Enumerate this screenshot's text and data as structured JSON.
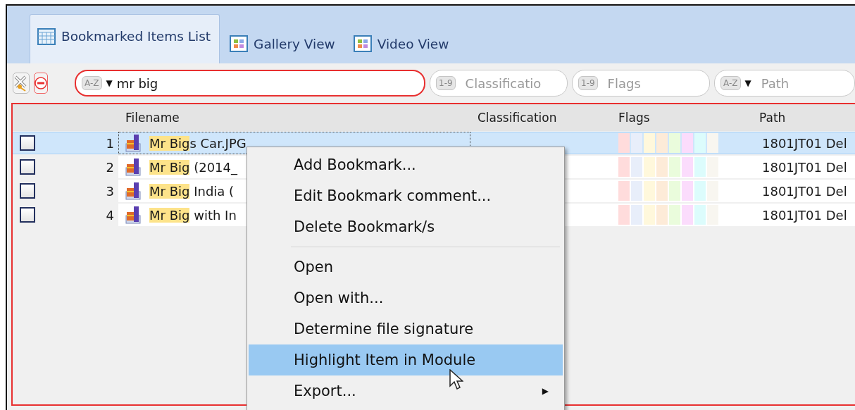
{
  "tabs": [
    {
      "label": "Bookmarked Items List",
      "selected": true,
      "kind": "table"
    },
    {
      "label": "Gallery View",
      "selected": false,
      "kind": "grid"
    },
    {
      "label": "Video View",
      "selected": false,
      "kind": "grid"
    }
  ],
  "filters": [
    {
      "badge": "A-Z",
      "caret": "▼",
      "value": "mr big",
      "active": true
    },
    {
      "badge": "1-9",
      "placeholder": "Classificatio",
      "active": false
    },
    {
      "badge": "1-9",
      "placeholder": "Flags",
      "active": false
    },
    {
      "badge": "A-Z",
      "caret": "▼",
      "placeholder": "Path",
      "active": false
    }
  ],
  "table": {
    "columns": [
      "Filename",
      "Classification",
      "Flags",
      "Path"
    ],
    "flag_slots": [
      {
        "color": "#ffdcdc"
      },
      {
        "color": "#e8eefa"
      },
      {
        "color": "#fff8dc"
      },
      {
        "color": "#fdebd8"
      },
      {
        "color": "#eafcdc"
      },
      {
        "color": "#fbdcfc"
      },
      {
        "color": "#dcfcfc"
      },
      {
        "color": "#f8f6f0"
      }
    ],
    "rows": [
      {
        "checked": false,
        "selected": true,
        "number": "1",
        "match": "Mr Big",
        "rest": "s Car.JPG",
        "path": "1801JT01 Del"
      },
      {
        "checked": false,
        "selected": false,
        "number": "2",
        "match": "Mr Big",
        "rest": " (2014_",
        "path": "1801JT01 Del"
      },
      {
        "checked": false,
        "selected": false,
        "number": "3",
        "match": "Mr Big",
        "rest": " India (",
        "path": "1801JT01 Del"
      },
      {
        "checked": false,
        "selected": false,
        "number": "4",
        "match": "Mr Big",
        "rest": " with In",
        "path": "1801JT01 Del"
      }
    ]
  },
  "context_menu": [
    {
      "kind": "item",
      "label": "Add Bookmark...",
      "selected": false
    },
    {
      "kind": "item",
      "label": "Edit Bookmark comment...",
      "selected": false
    },
    {
      "kind": "item",
      "label": "Delete Bookmark/s",
      "selected": false
    },
    {
      "kind": "separator"
    },
    {
      "kind": "item",
      "label": "Open",
      "selected": false
    },
    {
      "kind": "item",
      "label": "Open with...",
      "selected": false
    },
    {
      "kind": "item",
      "label": "Determine file signature",
      "selected": false
    },
    {
      "kind": "item",
      "label": "Highlight Item in Module",
      "selected": true
    },
    {
      "kind": "submenu",
      "label": "Export...",
      "arrow": "▶",
      "selected": false
    }
  ]
}
